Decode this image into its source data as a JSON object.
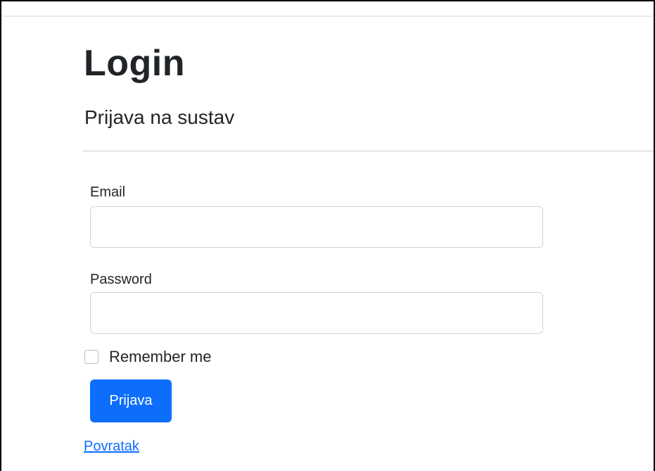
{
  "page": {
    "title": "Login",
    "subtitle": "Prijava na sustav"
  },
  "form": {
    "email_label": "Email",
    "email_value": "",
    "password_label": "Password",
    "password_value": "",
    "remember_label": "Remember me",
    "remember_checked": false,
    "submit_label": "Prijava"
  },
  "links": {
    "back_label": "Povratak"
  },
  "colors": {
    "primary": "#0d6efd",
    "text": "#212529",
    "border": "#ced4da"
  }
}
